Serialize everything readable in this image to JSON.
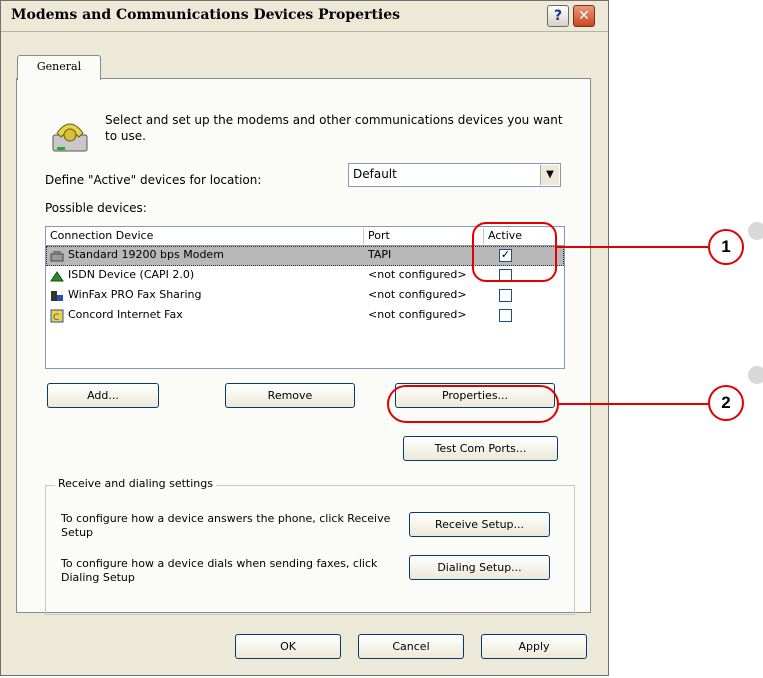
{
  "window": {
    "title": "Modems and Communications Devices Properties",
    "help_glyph": "?",
    "close_glyph": "✕"
  },
  "tabs": [
    {
      "label": "General",
      "active": true
    }
  ],
  "intro_text": "Select and set up the modems and other communications devices you want to use.",
  "location": {
    "label": "Define \"Active\" devices for location:",
    "value": "Default",
    "arrow": "▼"
  },
  "devices": {
    "label": "Possible devices:",
    "columns": [
      "Connection Device",
      "Port",
      "Active"
    ],
    "rows": [
      {
        "device": "Standard 19200 bps Modem",
        "port": "TAPI",
        "active": true,
        "selected": true,
        "icon": "modem-icon"
      },
      {
        "device": "ISDN Device (CAPI 2.0)",
        "port": "<not configured>",
        "active": false,
        "selected": false,
        "icon": "isdn-icon"
      },
      {
        "device": "WinFax PRO Fax Sharing",
        "port": "<not configured>",
        "active": false,
        "selected": false,
        "icon": "fax-sharing-icon"
      },
      {
        "device": "Concord Internet Fax",
        "port": "<not configured>",
        "active": false,
        "selected": false,
        "icon": "internet-fax-icon"
      }
    ],
    "check_glyph": "✓"
  },
  "buttons": {
    "add": "Add...",
    "remove": "Remove",
    "properties": "Properties...",
    "test_com_ports": "Test Com Ports...",
    "receive_setup": "Receive Setup...",
    "dialing_setup": "Dialing Setup...",
    "ok": "OK",
    "cancel": "Cancel",
    "apply": "Apply"
  },
  "receive_group": {
    "label": "Receive and dialing settings",
    "receive_desc": "To configure how a device answers the phone, click Receive Setup",
    "dialing_desc": "To configure how a device dials when sending faxes, click Dialing Setup"
  },
  "callouts": [
    "1",
    "2"
  ],
  "colors": {
    "callout_red": "#e00000",
    "window_bg": "#ece9d8"
  }
}
